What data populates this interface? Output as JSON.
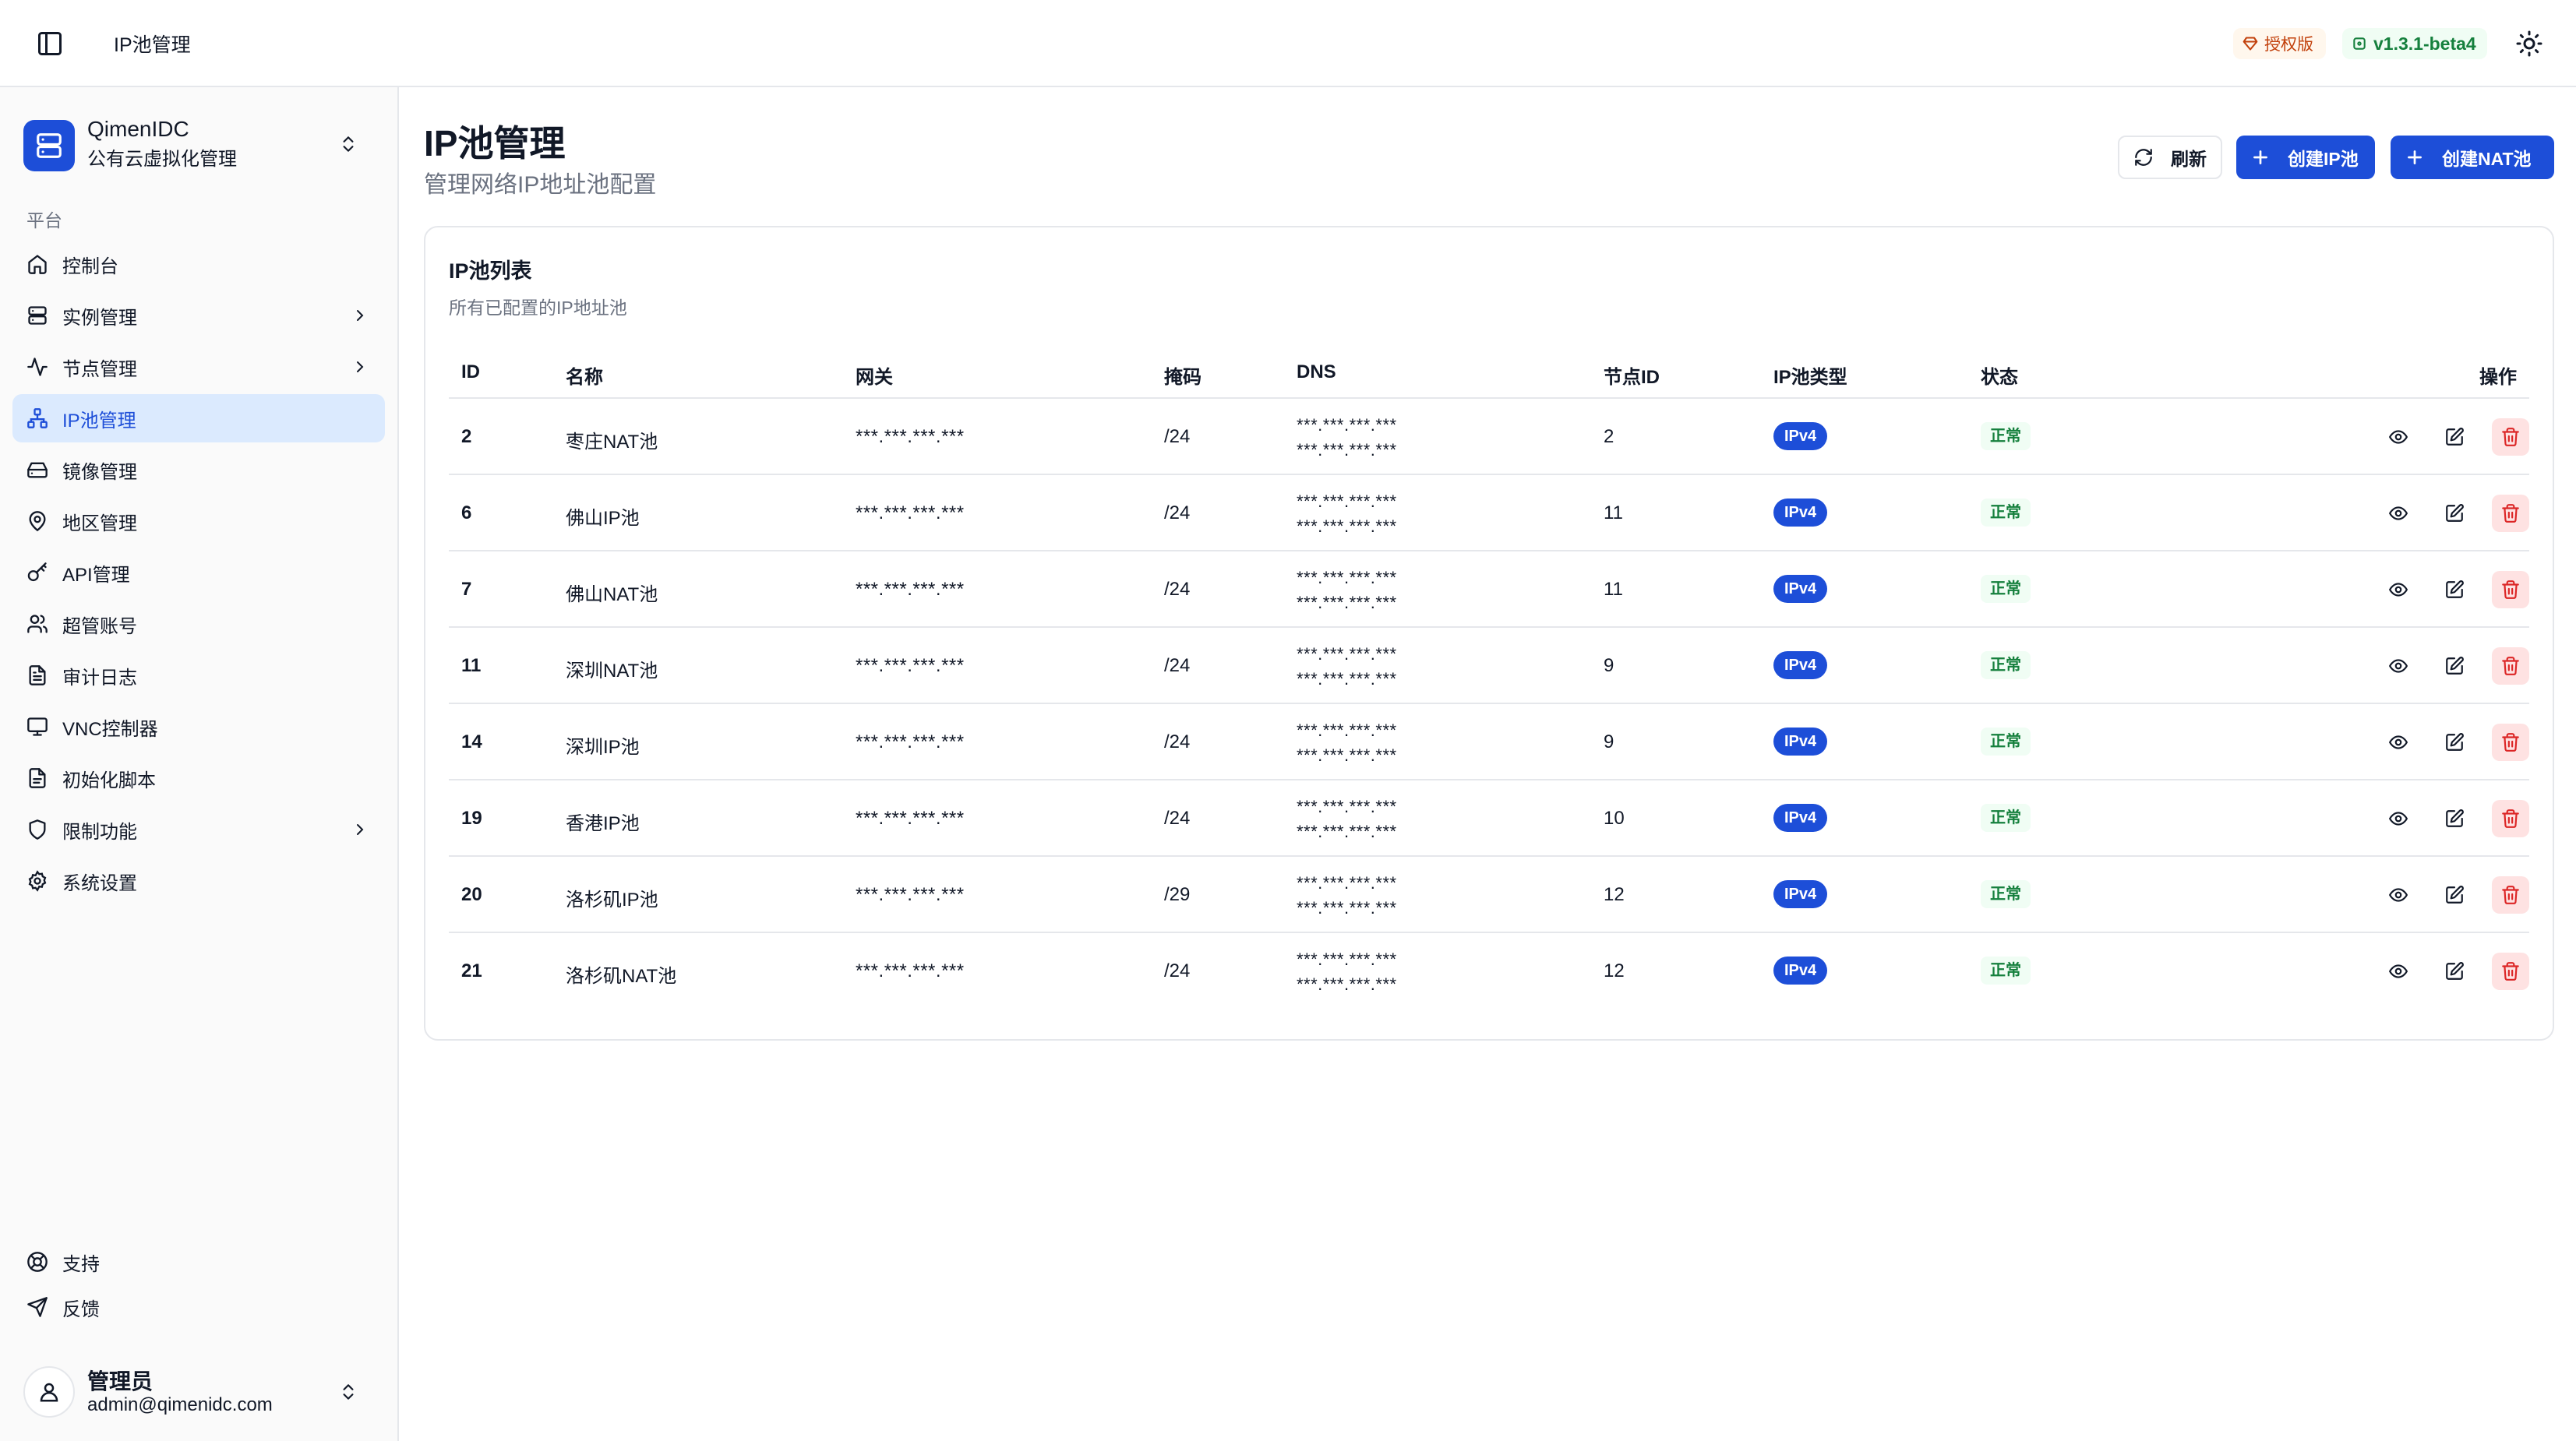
{
  "topbar": {
    "breadcrumb": "IP池管理",
    "license_badge": "授权版",
    "version_badge": "v1.3.1-beta4"
  },
  "sidebar": {
    "org_name": "QimenIDC",
    "org_subtitle": "公有云虚拟化管理",
    "group_label": "平台",
    "items": [
      {
        "label": "控制台",
        "icon": "home-icon"
      },
      {
        "label": "实例管理",
        "icon": "server-icon",
        "has_submenu": true
      },
      {
        "label": "节点管理",
        "icon": "activity-icon",
        "has_submenu": true
      },
      {
        "label": "IP池管理",
        "icon": "network-icon",
        "active": true
      },
      {
        "label": "镜像管理",
        "icon": "hard-drive-icon"
      },
      {
        "label": "地区管理",
        "icon": "map-pin-icon"
      },
      {
        "label": "API管理",
        "icon": "key-icon"
      },
      {
        "label": "超管账号",
        "icon": "users-icon"
      },
      {
        "label": "审计日志",
        "icon": "file-text-icon"
      },
      {
        "label": "VNC控制器",
        "icon": "monitor-icon"
      },
      {
        "label": "初始化脚本",
        "icon": "file-code-icon"
      },
      {
        "label": "限制功能",
        "icon": "shield-icon",
        "has_submenu": true
      },
      {
        "label": "系统设置",
        "icon": "settings-icon"
      }
    ],
    "bottom_items": [
      {
        "label": "支持",
        "icon": "life-buoy-icon"
      },
      {
        "label": "反馈",
        "icon": "send-icon"
      }
    ],
    "user": {
      "name": "管理员",
      "email": "admin@qimenidc.com"
    }
  },
  "main": {
    "title": "IP池管理",
    "subtitle": "管理网络IP地址池配置",
    "buttons": {
      "refresh": "刷新",
      "create_ip": "创建IP池",
      "create_nat": "创建NAT池"
    },
    "card": {
      "title": "IP池列表",
      "subtitle": "所有已配置的IP地址池"
    },
    "table": {
      "headers": {
        "id": "ID",
        "name": "名称",
        "gateway": "网关",
        "mask": "掩码",
        "dns": "DNS",
        "node_id": "节点ID",
        "type": "IP池类型",
        "status": "状态",
        "ops": "操作"
      },
      "rows": [
        {
          "id": "2",
          "name": "枣庄NAT池",
          "gateway": "***.***.***.***",
          "mask": "/24",
          "dns1": "***.***.***.***",
          "dns2": "***.***.***.***",
          "node_id": "2",
          "type": "IPv4",
          "status": "正常"
        },
        {
          "id": "6",
          "name": "佛山IP池",
          "gateway": "***.***.***.***",
          "mask": "/24",
          "dns1": "***.***.***.***",
          "dns2": "***.***.***.***",
          "node_id": "11",
          "type": "IPv4",
          "status": "正常"
        },
        {
          "id": "7",
          "name": "佛山NAT池",
          "gateway": "***.***.***.***",
          "mask": "/24",
          "dns1": "***.***.***.***",
          "dns2": "***.***.***.***",
          "node_id": "11",
          "type": "IPv4",
          "status": "正常"
        },
        {
          "id": "11",
          "name": "深圳NAT池",
          "gateway": "***.***.***.***",
          "mask": "/24",
          "dns1": "***.***.***.***",
          "dns2": "***.***.***.***",
          "node_id": "9",
          "type": "IPv4",
          "status": "正常"
        },
        {
          "id": "14",
          "name": "深圳IP池",
          "gateway": "***.***.***.***",
          "mask": "/24",
          "dns1": "***.***.***.***",
          "dns2": "***.***.***.***",
          "node_id": "9",
          "type": "IPv4",
          "status": "正常"
        },
        {
          "id": "19",
          "name": "香港IP池",
          "gateway": "***.***.***.***",
          "mask": "/24",
          "dns1": "***.***.***.***",
          "dns2": "***.***.***.***",
          "node_id": "10",
          "type": "IPv4",
          "status": "正常"
        },
        {
          "id": "20",
          "name": "洛杉矶IP池",
          "gateway": "***.***.***.***",
          "mask": "/29",
          "dns1": "***.***.***.***",
          "dns2": "***.***.***.***",
          "node_id": "12",
          "type": "IPv4",
          "status": "正常"
        },
        {
          "id": "21",
          "name": "洛杉矶NAT池",
          "gateway": "***.***.***.***",
          "mask": "/24",
          "dns1": "***.***.***.***",
          "dns2": "***.***.***.***",
          "node_id": "12",
          "type": "IPv4",
          "status": "正常"
        }
      ]
    }
  },
  "colors": {
    "primary": "#1d4ed8",
    "active_bg": "#dbeafe",
    "success_text": "#15803d",
    "success_bg": "#f0fdf4",
    "danger": "#dc2626",
    "danger_bg": "#fee2e2",
    "license": "#c2410c"
  }
}
